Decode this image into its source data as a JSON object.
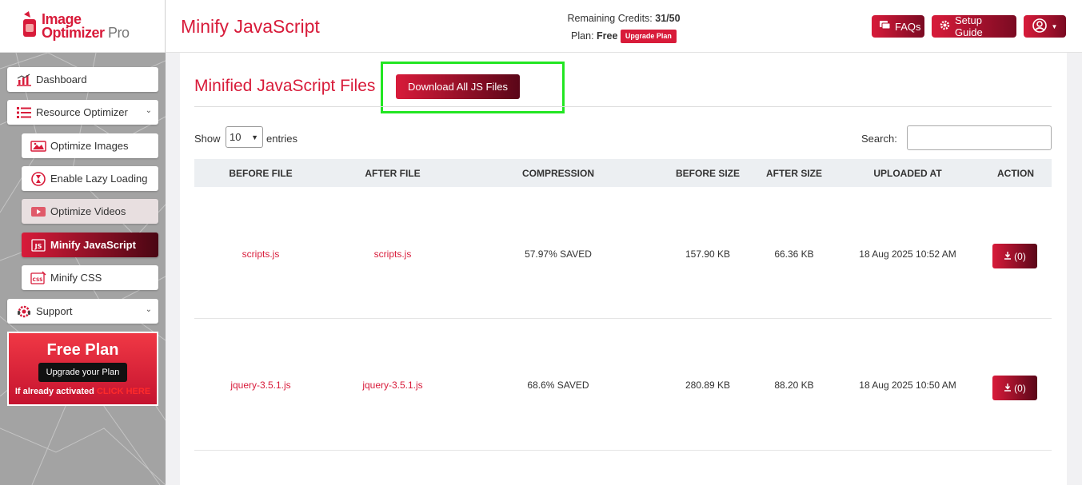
{
  "header": {
    "logo_line1": "Image",
    "logo_line2": "Optimizer",
    "logo_pro": "Pro",
    "page_title": "Minify JavaScript",
    "credits_label": "Remaining Credits:",
    "credits_value": "31/50",
    "plan_label": "Plan:",
    "plan_value": "Free",
    "upgrade_plan_label": "Upgrade Plan",
    "faqs_label": "FAQs",
    "setup_guide_label": "Setup Guide"
  },
  "sidebar": {
    "items": [
      {
        "label": "Dashboard",
        "icon": "chart-icon"
      },
      {
        "label": "Resource Optimizer",
        "icon": "list-icon"
      },
      {
        "label": "Optimize Images",
        "icon": "image-icon"
      },
      {
        "label": "Enable Lazy Loading",
        "icon": "hourglass-icon"
      },
      {
        "label": "Optimize Videos",
        "icon": "video-icon"
      },
      {
        "label": "Minify JavaScript",
        "icon": "js-icon"
      },
      {
        "label": "Minify CSS",
        "icon": "css-icon"
      },
      {
        "label": "Support",
        "icon": "headset-icon"
      }
    ],
    "plan_card": {
      "title": "Free Plan",
      "button": "Upgrade your Plan",
      "activated_text": "If already activated",
      "click_here": "CLICK HERE"
    }
  },
  "main": {
    "title": "Minified JavaScript Files",
    "download_all_label": "Download All JS Files",
    "show_label": "Show",
    "entries_value": "10",
    "entries_label": "entries",
    "search_label": "Search:",
    "search_value": "",
    "columns": [
      "BEFORE FILE",
      "AFTER FILE",
      "COMPRESSION",
      "BEFORE SIZE",
      "AFTER SIZE",
      "UPLOADED AT",
      "ACTION"
    ],
    "rows": [
      {
        "before_file": "scripts.js",
        "after_file": "scripts.js",
        "compression": "57.97% SAVED",
        "before_size": "157.90 KB",
        "after_size": "66.36 KB",
        "uploaded_at": "18 Aug 2025 10:52 AM",
        "action": "(0)"
      },
      {
        "before_file": "jquery-3.5.1.js",
        "after_file": "jquery-3.5.1.js",
        "compression": "68.6% SAVED",
        "before_size": "280.89 KB",
        "after_size": "88.20 KB",
        "uploaded_at": "18 Aug 2025 10:50 AM",
        "action": "(0)"
      }
    ]
  },
  "colors": {
    "brand": "#d81b3a",
    "brand_dark": "#5a0618",
    "highlight": "#22e622"
  }
}
